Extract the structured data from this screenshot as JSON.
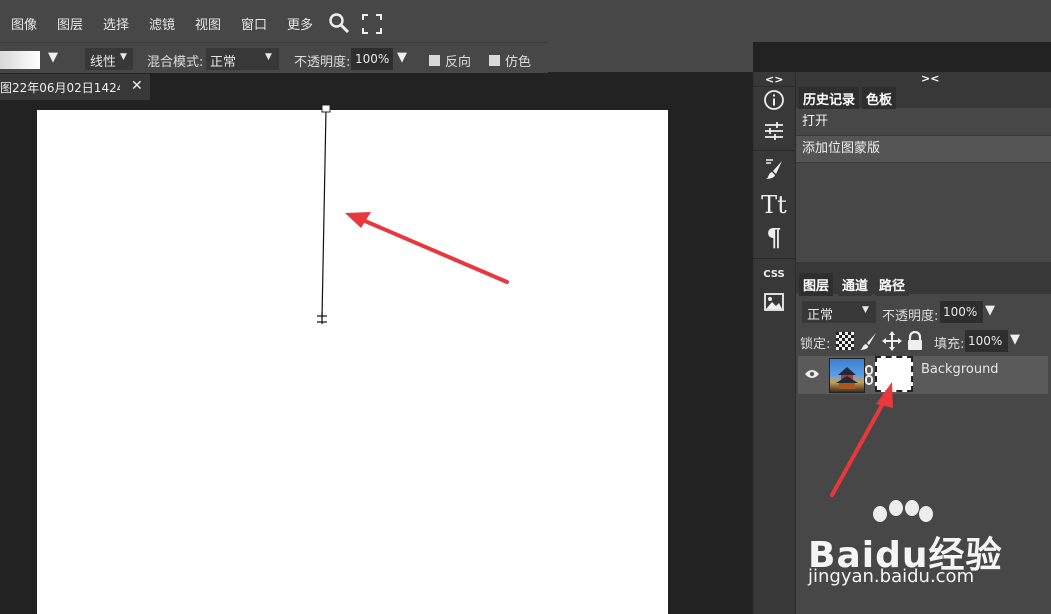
{
  "menubar": {
    "items": [
      "图像",
      "图层",
      "选择",
      "滤镜",
      "视图",
      "窗口",
      "更多"
    ]
  },
  "options": {
    "gradient_type": "线性",
    "blend_mode_label": "混合模式:",
    "blend_mode_value": "正常",
    "opacity_label": "不透明度:",
    "opacity_value": "100%",
    "reverse_label": "反向",
    "dither_label": "仿色"
  },
  "document": {
    "tab_title": "图22年06月02日1424",
    "close_glyph": "✕"
  },
  "panel_toggles": {
    "left": "<>",
    "right": "><"
  },
  "tools": {
    "type_glyph": "Tt",
    "paragraph_glyph": "¶",
    "css_label": "CSS"
  },
  "history_panel": {
    "tabs": [
      "历史记录",
      "色板"
    ],
    "items": [
      "打开",
      "添加位图蒙版"
    ]
  },
  "layers_panel": {
    "tabs": [
      "图层",
      "通道",
      "路径"
    ],
    "blend_mode": "正常",
    "opacity_label": "不透明度:",
    "opacity_value": "100%",
    "lock_label": "锁定:",
    "fill_label": "填充:",
    "fill_value": "100%",
    "layer_name": "Background"
  },
  "watermark": {
    "brand": "Baidu经验",
    "url": "jingyan.baidu.com"
  },
  "colors": {
    "annotation_arrow": "#e8383d",
    "panel_bg": "#474747",
    "selected_layer_bg": "#5a5a5a"
  }
}
